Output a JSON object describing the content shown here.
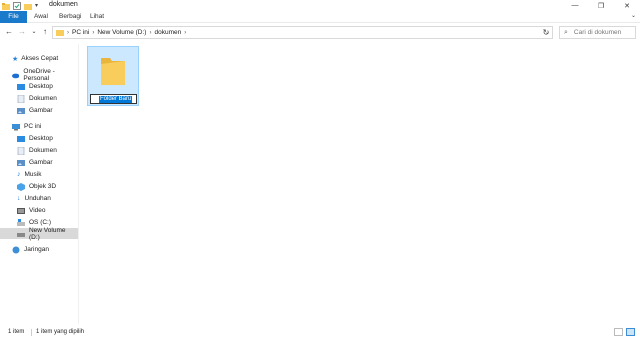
{
  "window": {
    "title": "dokumen",
    "minimize_icon": "minimize-icon",
    "maximize_icon": "restore-icon",
    "close_icon": "close-icon"
  },
  "ribbon": {
    "tabs": [
      "File",
      "Awal",
      "Berbagi",
      "Lihat"
    ]
  },
  "address": {
    "crumbs": [
      "PC ini",
      "New Volume (D:)",
      "dokumen"
    ],
    "search_placeholder": "Cari di dokumen"
  },
  "sidebar": {
    "items": [
      {
        "label": "Akses Cepat",
        "icon": "star-icon"
      },
      {
        "label": "OneDrive - Personal",
        "icon": "cloud-icon"
      },
      {
        "label": "Desktop",
        "icon": "desktop-icon"
      },
      {
        "label": "Dokumen",
        "icon": "document-icon"
      },
      {
        "label": "Gambar",
        "icon": "picture-icon"
      },
      {
        "label": "PC ini",
        "icon": "computer-icon"
      },
      {
        "label": "Desktop",
        "icon": "desktop-icon"
      },
      {
        "label": "Dokumen",
        "icon": "document-icon"
      },
      {
        "label": "Gambar",
        "icon": "picture-icon"
      },
      {
        "label": "Musik",
        "icon": "music-icon"
      },
      {
        "label": "Objek 3D",
        "icon": "cube-icon"
      },
      {
        "label": "Unduhan",
        "icon": "download-icon"
      },
      {
        "label": "Video",
        "icon": "video-icon"
      },
      {
        "label": "OS (C:)",
        "icon": "drive-icon"
      },
      {
        "label": "New Volume (D:)",
        "icon": "drive-icon"
      },
      {
        "label": "Jaringan",
        "icon": "network-icon"
      }
    ]
  },
  "content": {
    "folder_name": "Folder Baru"
  },
  "status": {
    "count": "1 item",
    "selected": "1 item yang dipilih"
  },
  "colors": {
    "accent": "#1979ca",
    "selection_bg": "#cce8ff",
    "folder": "#f8cd5b"
  }
}
